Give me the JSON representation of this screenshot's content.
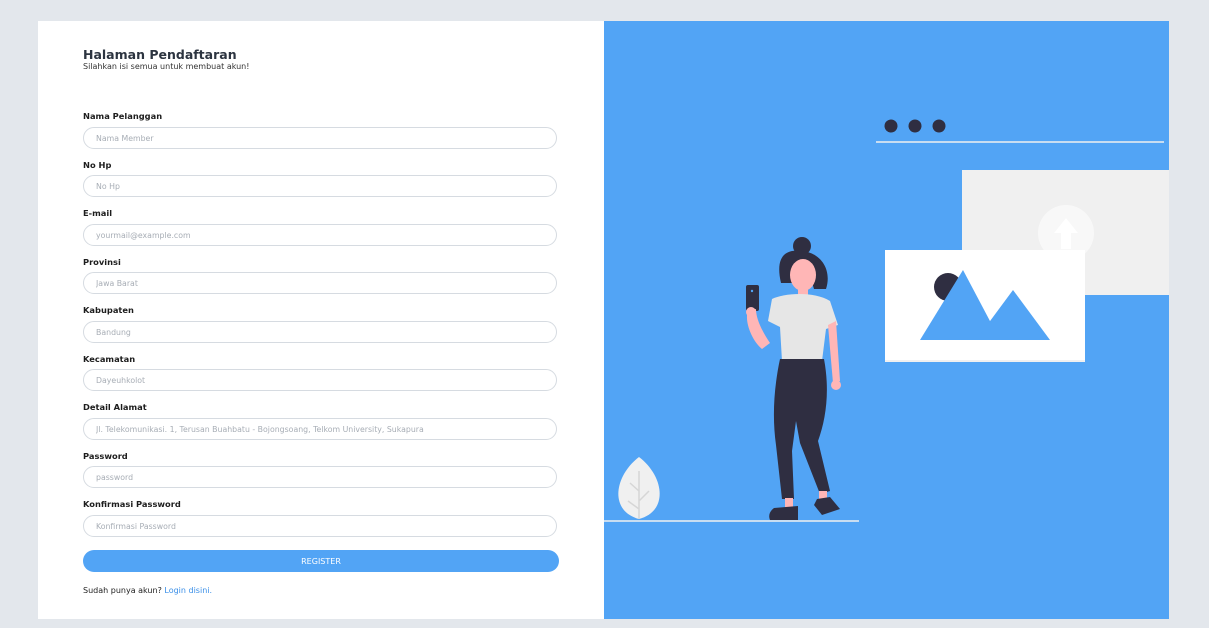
{
  "form": {
    "title": "Halaman Pendaftaran",
    "subtitle": "Silahkan isi semua untuk membuat akun!",
    "fields": [
      {
        "label": "Nama Pelanggan",
        "placeholder": "Nama Member",
        "value": ""
      },
      {
        "label": "No Hp",
        "placeholder": "No Hp",
        "value": ""
      },
      {
        "label": "E-mail",
        "placeholder": "yourmail@example.com",
        "value": ""
      },
      {
        "label": "Provinsi",
        "placeholder": "Jawa Barat",
        "value": ""
      },
      {
        "label": "Kabupaten",
        "placeholder": "Bandung",
        "value": ""
      },
      {
        "label": "Kecamatan",
        "placeholder": "Dayeuhkolot",
        "value": ""
      },
      {
        "label": "Detail Alamat",
        "placeholder": "Jl. Telekomunikasi. 1, Terusan Buahbatu - Bojongsoang, Telkom University, Sukapura",
        "value": ""
      },
      {
        "label": "Password",
        "placeholder": "password",
        "value": ""
      },
      {
        "label": "Konfirmasi Password",
        "placeholder": "Konfirmasi Password",
        "value": ""
      }
    ],
    "register_label": "REGISTER",
    "login_prompt": "Sudah punya akun?",
    "login_link": "Login disini."
  },
  "colors": {
    "accent": "#52a4f5",
    "page_background": "#e3e7ec",
    "illustration_dark": "#2f2e41",
    "illustration_skin": "#ffb6b6",
    "illustration_light": "#f0f0f0"
  },
  "icons": {
    "upload": "arrow-up-icon",
    "image": "image-placeholder-icon"
  }
}
